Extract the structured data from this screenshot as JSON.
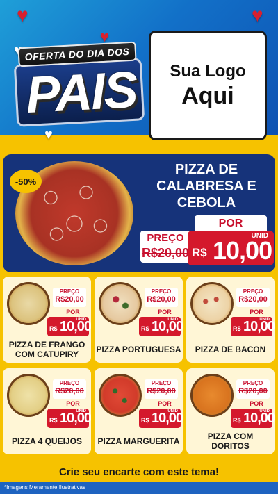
{
  "header": {
    "campaign_banner": "OFERTA DO DIA DOS",
    "campaign_title": "PAIS",
    "logo_line1": "Sua Logo",
    "logo_line2": "Aqui"
  },
  "featured": {
    "discount": "-50%",
    "name": "PIZZA DE CALABRESA E CEBOLA",
    "price_label": "PREÇO",
    "old_price": "R$20,00",
    "por_label": "POR",
    "unit_label": "UNID",
    "currency": "R$",
    "new_price": "10,00"
  },
  "products": [
    {
      "name": "PIZZA DE FRANGO COM CATUPIRY",
      "price_label": "PREÇO",
      "old_price": "R$20,00",
      "por_label": "POR",
      "unit_label": "UNID",
      "currency": "R$",
      "new_price": "10,00"
    },
    {
      "name": "PIZZA PORTUGUESA",
      "price_label": "PREÇO",
      "old_price": "R$20,00",
      "por_label": "POR",
      "unit_label": "UNID",
      "currency": "R$",
      "new_price": "10,00"
    },
    {
      "name": "PIZZA DE BACON",
      "price_label": "PREÇO",
      "old_price": "R$20,00",
      "por_label": "POR",
      "unit_label": "UNID",
      "currency": "R$",
      "new_price": "10,00"
    },
    {
      "name": "PIZZA 4 QUEIJOS",
      "price_label": "PREÇO",
      "old_price": "R$20,00",
      "por_label": "POR",
      "unit_label": "UNID",
      "currency": "R$",
      "new_price": "10,00"
    },
    {
      "name": "PIZZA MARGUERITA",
      "price_label": "PREÇO",
      "old_price": "R$20,00",
      "por_label": "POR",
      "unit_label": "UNID",
      "currency": "R$",
      "new_price": "10,00"
    },
    {
      "name": "PIZZA COM DORITOS",
      "price_label": "PREÇO",
      "old_price": "R$20,00",
      "por_label": "POR",
      "unit_label": "UNID",
      "currency": "R$",
      "new_price": "10,00"
    }
  ],
  "footer": {
    "cta": "Crie seu encarte com este tema!",
    "disclaimer": "*Imagens Meramente Ilustrativas"
  },
  "colors": {
    "background_yellow": "#f6c200",
    "header_blue": "#1270c8",
    "hero_navy": "#16337a",
    "price_red": "#d4182c",
    "card_cream": "#fff6d6"
  },
  "icons": [
    "heart-icon",
    "pizza-image"
  ]
}
